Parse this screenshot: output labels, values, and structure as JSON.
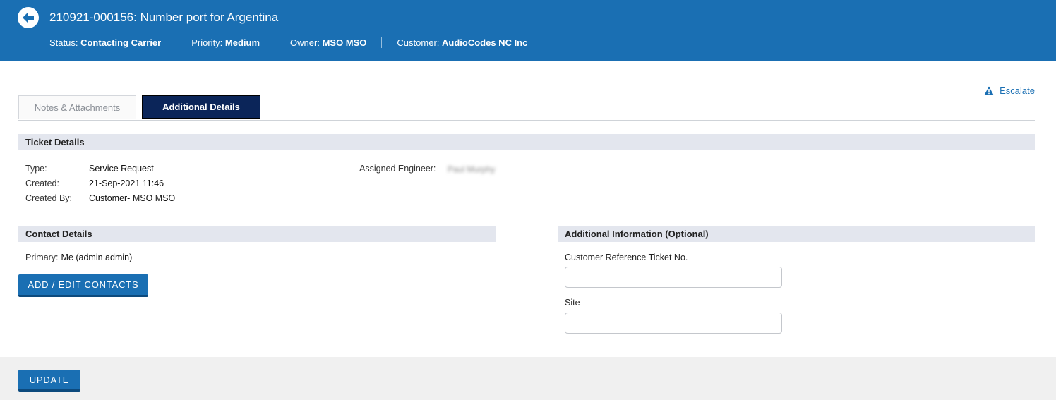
{
  "header": {
    "title": "210921-000156: Number port for Argentina",
    "status_label": "Status:",
    "status_value": "Contacting Carrier",
    "priority_label": "Priority:",
    "priority_value": "Medium",
    "owner_label": "Owner:",
    "owner_value": "MSO MSO",
    "customer_label": "Customer:",
    "customer_value": "AudioCodes NC Inc"
  },
  "escalate_label": "Escalate",
  "tabs": [
    {
      "label": "Notes & Attachments",
      "active": false
    },
    {
      "label": "Additional Details",
      "active": true
    }
  ],
  "ticket_details": {
    "heading": "Ticket Details",
    "type_label": "Type:",
    "type_value": "Service Request",
    "created_label": "Created:",
    "created_value": "21-Sep-2021 11:46",
    "created_by_label": "Created By:",
    "created_by_value": "Customer- MSO MSO",
    "engineer_label": "Assigned Engineer:",
    "engineer_value": "Paul Murphy"
  },
  "contact_details": {
    "heading": "Contact Details",
    "primary_label": "Primary:",
    "primary_value": "Me (admin  admin)",
    "button_label": "ADD / EDIT CONTACTS"
  },
  "additional_info": {
    "heading": "Additional Information (Optional)",
    "ref_label": "Customer Reference Ticket No.",
    "ref_value": "",
    "site_label": "Site",
    "site_value": ""
  },
  "footer": {
    "update_label": "UPDATE"
  },
  "colors": {
    "header_bg": "#1a6fb3",
    "active_tab_bg": "#0b2559",
    "section_bar_bg": "#e3e6ee",
    "button_bg": "#1a6fb3"
  }
}
